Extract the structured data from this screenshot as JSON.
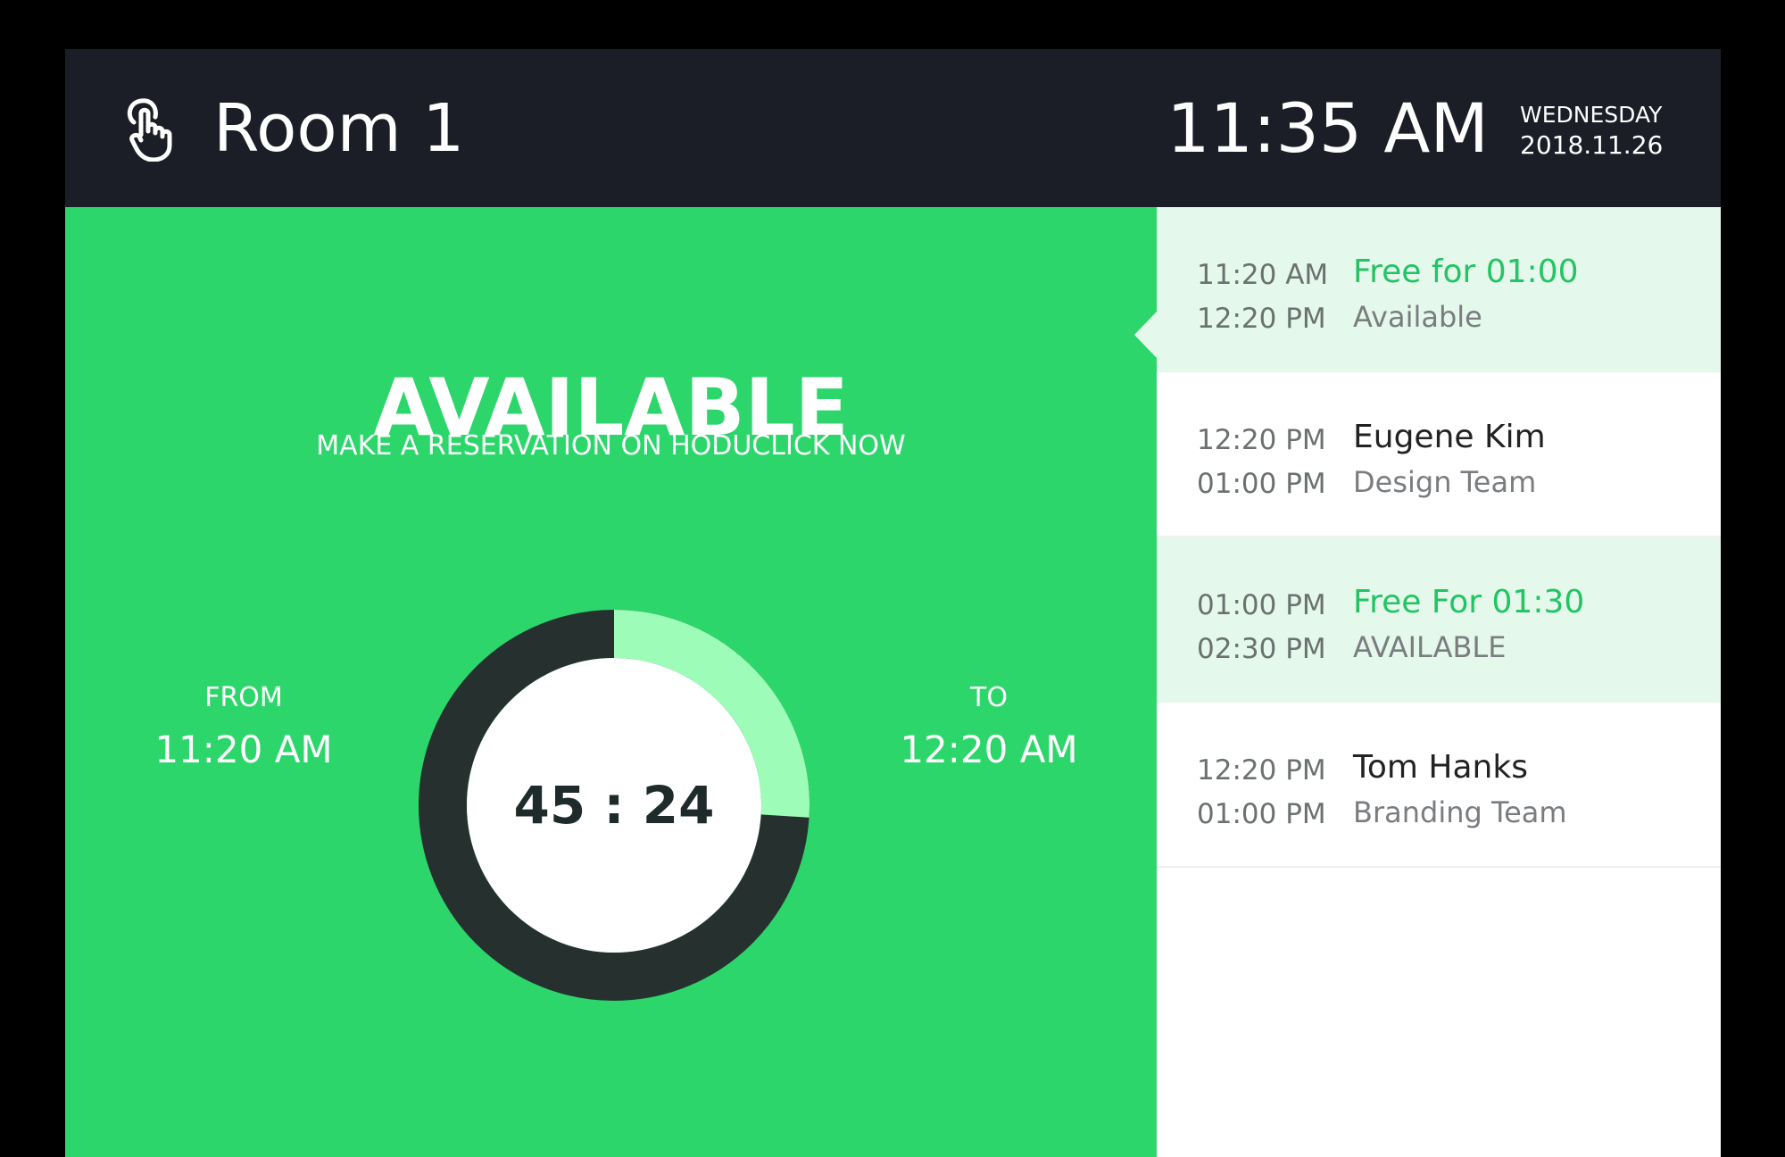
{
  "header": {
    "room_name": "Room 1",
    "time": "11:35 AM",
    "day": "WEDNESDAY",
    "date": "2018.11.26",
    "icon": "touch-hand-icon"
  },
  "main": {
    "status": "AVAILABLE",
    "subtitle": "MAKE A RESERVATION ON HODUCLICK NOW",
    "from_label": "FROM",
    "from_time": "11:20 AM",
    "to_label": "TO",
    "to_time": "12:20 AM",
    "timer": "45 : 24",
    "timer_progress_fraction": 0.26
  },
  "schedule": [
    {
      "start": "11:20 AM",
      "end": "12:20 PM",
      "title": "Free for 01:00",
      "subtitle": "Available",
      "free": true
    },
    {
      "start": "12:20 PM",
      "end": "01:00 PM",
      "title": "Eugene Kim",
      "subtitle": "Design Team",
      "free": false
    },
    {
      "start": "01:00 PM",
      "end": "02:30 PM",
      "title": "Free For 01:30",
      "subtitle": "AVAILABLE",
      "free": true
    },
    {
      "start": "12:20 PM",
      "end": "01:00 PM",
      "title": "Tom Hanks",
      "subtitle": "Branding Team",
      "free": false
    }
  ],
  "colors": {
    "header_bg": "#1b1e26",
    "available_green": "#2dd66b",
    "ring_track": "#26312f",
    "ring_progress": "#9dfcb8",
    "free_slot_bg": "#e5f8ec",
    "free_title": "#23c463"
  }
}
